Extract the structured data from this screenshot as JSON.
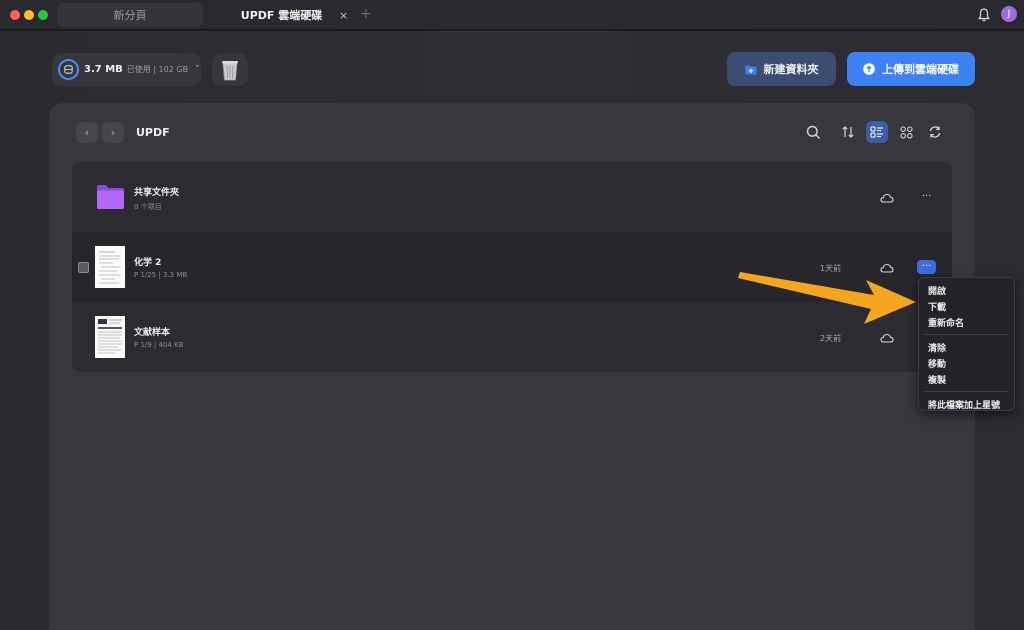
{
  "window": {
    "tabs": [
      {
        "label": "新分頁",
        "active": false
      },
      {
        "label": "UPDF 雲端硬碟",
        "active": true
      }
    ],
    "tab_close": "×",
    "tab_add": "+",
    "user_initial": "J"
  },
  "storage": {
    "used": "3.7 MB",
    "total": "已使用 | 102 GB",
    "chevron": "˅"
  },
  "actions": {
    "new_folder": "新建資料夾",
    "upload": "上傳到雲端硬碟"
  },
  "breadcrumb": {
    "back": "‹",
    "forward": "›",
    "current": "UPDF"
  },
  "files": [
    {
      "name": "共享文件夾",
      "meta": "0 个项目",
      "time": "",
      "type": "folder"
    },
    {
      "name": "化学 2",
      "meta": "P 1/25  |  3.3 MB",
      "time": "1天前",
      "type": "pdf"
    },
    {
      "name": "文献样本",
      "meta": "P 1/9  |  404 KB",
      "time": "2天前",
      "type": "pdf"
    }
  ],
  "more_label": "···",
  "context_menu": {
    "group1": [
      "開啟",
      "下載",
      "重新命名"
    ],
    "group2": [
      "清除",
      "移動",
      "複製"
    ],
    "group3": [
      "將此檔案加上星號"
    ]
  },
  "colors": {
    "accent": "#3c82f6",
    "folder": "#a35ef0",
    "arrow": "#f6a521"
  },
  "icons": {
    "bell": "bell-icon",
    "trash": "trash-icon",
    "cloud": "cloud-icon",
    "search": "search-icon",
    "sort": "sort-icon",
    "list_view": "list-view-icon",
    "grid_view": "grid-view-icon",
    "refresh": "refresh-icon"
  }
}
